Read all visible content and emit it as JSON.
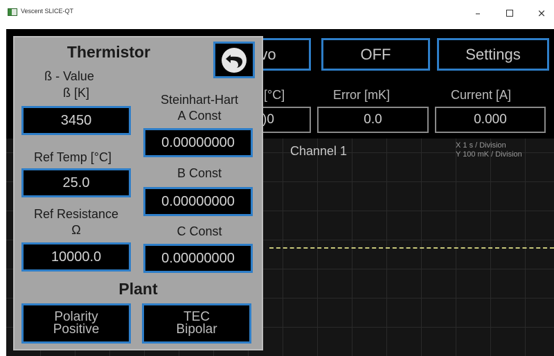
{
  "window": {
    "title": "Vescent SLICE-QT",
    "minimize_glyph": "–",
    "close_glyph": "×"
  },
  "toolbar": {
    "servo_label": "vo",
    "off_label": "OFF",
    "settings_label": "Settings"
  },
  "readouts": {
    "temp_label": "[°C]",
    "temp_value": ")0",
    "error_label": "Error [mK]",
    "error_value": "0.0",
    "current_label": "Current [A]",
    "current_value": "0.000"
  },
  "graph": {
    "title": "Channel 1",
    "x_scale": "X  1 s / Division",
    "y_scale": "Y  100 mK / Division"
  },
  "thermistor": {
    "title": "Thermistor",
    "beta_heading": "ß - Value",
    "beta_label": "ß [K]",
    "beta_value": "3450",
    "ref_temp_label": "Ref Temp [°C]",
    "ref_temp_value": "25.0",
    "ref_res_label": "Ref Resistance",
    "ref_res_unit": "Ω",
    "ref_res_value": "10000.0",
    "sh_heading": "Steinhart-Hart",
    "a_label": "A Const",
    "a_value": "0.00000000",
    "b_label": "B Const",
    "b_value": "0.00000000",
    "c_label": "C Const",
    "c_value": "0.00000000"
  },
  "plant": {
    "title": "Plant",
    "polarity_line1": "Polarity",
    "polarity_line2": "Positive",
    "tec_line1": "TEC",
    "tec_line2": "Bipolar"
  },
  "colors": {
    "accent_border": "#2e7ec8",
    "panel_bg": "#a5a5a5",
    "app_bg": "#000000",
    "trace": "#c9c97a"
  },
  "icons": {
    "back": "undo-arrow-icon",
    "app": "app-logo-icon"
  }
}
